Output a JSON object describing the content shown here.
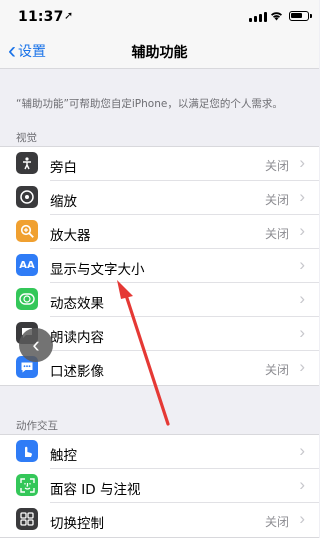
{
  "status_bar": {
    "time": "11:37",
    "location_icon": "location-arrow-icon",
    "battery_fraction": 0.8
  },
  "nav": {
    "back_label": "设置",
    "title": "辅助功能"
  },
  "description": "“辅助功能”可帮助您自定iPhone，以满足您的个人需求。",
  "sections": [
    {
      "header": "视觉",
      "items": [
        {
          "label": "旁白",
          "value": "关闭",
          "icon": "voiceover-icon",
          "color": "#3a3a3c"
        },
        {
          "label": "缩放",
          "value": "关闭",
          "icon": "zoom-icon",
          "color": "#3a3a3c"
        },
        {
          "label": "放大器",
          "value": "关闭",
          "icon": "magnifier-icon",
          "color": "#f0a030"
        },
        {
          "label": "显示与文字大小",
          "value": "",
          "icon": "text-size-icon",
          "color": "#2f7cf6"
        },
        {
          "label": "动态效果",
          "value": "",
          "icon": "motion-icon",
          "color": "#34c759"
        },
        {
          "label": "朗读内容",
          "value": "",
          "icon": "spoken-content-icon",
          "color": "#3a3a3c"
        },
        {
          "label": "口述影像",
          "value": "关闭",
          "icon": "audio-description-icon",
          "color": "#2f7cf6"
        }
      ]
    },
    {
      "header": "动作交互",
      "items": [
        {
          "label": "触控",
          "value": "",
          "icon": "touch-icon",
          "color": "#2f7cf6"
        },
        {
          "label": "面容 ID 与注视",
          "value": "",
          "icon": "face-id-icon",
          "color": "#34c759"
        },
        {
          "label": "切换控制",
          "value": "关闭",
          "icon": "switch-control-icon",
          "color": "#3a3a3c"
        }
      ]
    }
  ]
}
